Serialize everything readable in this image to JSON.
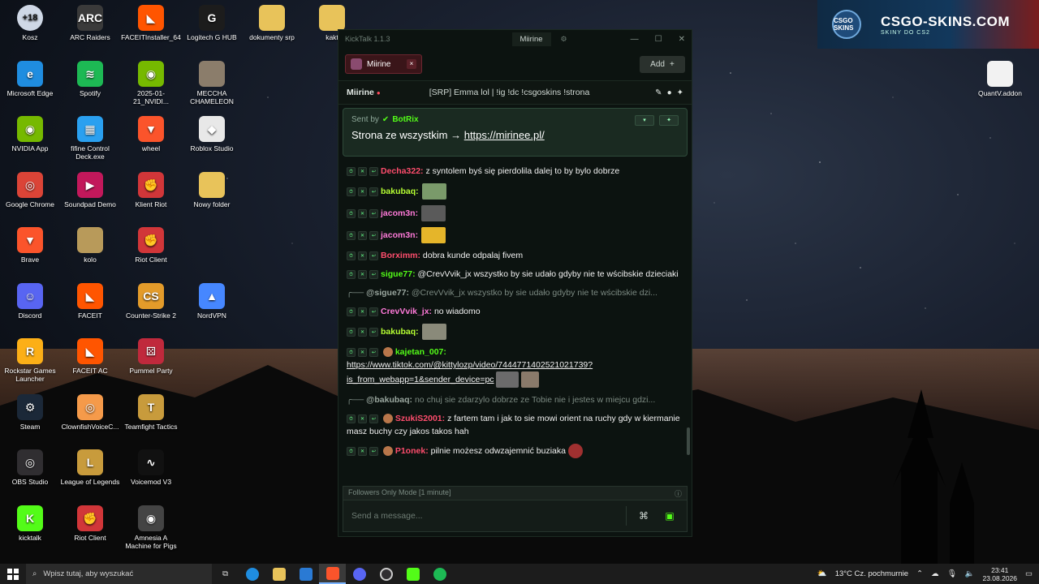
{
  "promo": {
    "badge": "CSGO SKINS",
    "title": "CSGO-SKINS.COM",
    "subtitle": "SKINY DO CS2"
  },
  "desktop_icons": [
    {
      "label": "Kosz",
      "icon": "recycle-bin-icon",
      "color": "#cfd8e6",
      "glyph": "+18"
    },
    {
      "label": "ARC Raiders",
      "icon": "arc-raiders-icon",
      "color": "#3a3a3a",
      "glyph": "ARC"
    },
    {
      "label": "FACEITInstaller_64",
      "icon": "faceit-icon",
      "color": "#ff5500",
      "glyph": "◣"
    },
    {
      "label": "Logitech G HUB",
      "icon": "logitech-icon",
      "color": "#1c1c1c",
      "glyph": "G"
    },
    {
      "label": "dokumenty srp",
      "icon": "folder-icon",
      "color": "#e8c35a",
      "glyph": ""
    },
    {
      "label": "kakt",
      "icon": "folder-icon",
      "color": "#e8c35a",
      "glyph": ""
    },
    {
      "label": "Microsoft Edge",
      "icon": "edge-icon",
      "color": "#1f8de0",
      "glyph": "e"
    },
    {
      "label": "Spotify",
      "icon": "spotify-icon",
      "color": "#1db954",
      "glyph": "≋"
    },
    {
      "label": "2025-01-21_NVIDI...",
      "icon": "nvidia-icon",
      "color": "#76b900",
      "glyph": "◉"
    },
    {
      "label": "MECCHA CHAMELEON",
      "icon": "game-icon",
      "color": "#8b7d6b",
      "glyph": ""
    },
    {
      "label": "NVIDIA App",
      "icon": "nvidia-icon",
      "color": "#76b900",
      "glyph": "◉"
    },
    {
      "label": "fifine Control Deck.exe",
      "icon": "fifine-icon",
      "color": "#2aa0f0",
      "glyph": "▦"
    },
    {
      "label": "wheel",
      "icon": "brave-icon",
      "color": "#fb542b",
      "glyph": "▼"
    },
    {
      "label": "Roblox Studio",
      "icon": "roblox-icon",
      "color": "#e8e8e8",
      "glyph": "◆"
    },
    {
      "label": "Google Chrome",
      "icon": "chrome-icon",
      "color": "#db4437",
      "glyph": "◎"
    },
    {
      "label": "Soundpad Demo",
      "icon": "soundpad-icon",
      "color": "#c2185b",
      "glyph": "▶"
    },
    {
      "label": "Klient Riot",
      "icon": "riot-icon",
      "color": "#d13639",
      "glyph": "✊"
    },
    {
      "label": "Nowy folder",
      "icon": "folder-icon",
      "color": "#e8c35a",
      "glyph": ""
    },
    {
      "label": "Brave",
      "icon": "brave-icon",
      "color": "#fb542b",
      "glyph": "▼"
    },
    {
      "label": "kolo",
      "icon": "archive-icon",
      "color": "#b89a5a",
      "glyph": ""
    },
    {
      "label": "Riot Client",
      "icon": "riot-icon",
      "color": "#d13639",
      "glyph": "✊"
    },
    {
      "label": "Discord",
      "icon": "discord-icon",
      "color": "#5865f2",
      "glyph": "☺"
    },
    {
      "label": "FACEIT",
      "icon": "faceit-icon",
      "color": "#ff5500",
      "glyph": "◣"
    },
    {
      "label": "Counter-Strike 2",
      "icon": "cs2-icon",
      "color": "#e39b2a",
      "glyph": "CS"
    },
    {
      "label": "NordVPN",
      "icon": "nordvpn-icon",
      "color": "#4687ff",
      "glyph": "▲"
    },
    {
      "label": "Rockstar Games Launcher",
      "icon": "rockstar-icon",
      "color": "#fcaf17",
      "glyph": "R"
    },
    {
      "label": "FACEIT AC",
      "icon": "faceit-icon",
      "color": "#ff5500",
      "glyph": "◣"
    },
    {
      "label": "Pummel Party",
      "icon": "pummel-icon",
      "color": "#c0293c",
      "glyph": "⚄"
    },
    {
      "label": "Steam",
      "icon": "steam-icon",
      "color": "#1b2838",
      "glyph": "⚙"
    },
    {
      "label": "ClownfishVoiceC...",
      "icon": "clownfish-icon",
      "color": "#f59a4a",
      "glyph": "◎"
    },
    {
      "label": "Teamfight Tactics",
      "icon": "tft-icon",
      "color": "#c89b3c",
      "glyph": "T"
    },
    {
      "label": "OBS Studio",
      "icon": "obs-icon",
      "color": "#302e31",
      "glyph": "◎"
    },
    {
      "label": "League of Legends",
      "icon": "lol-icon",
      "color": "#c89b3c",
      "glyph": "L"
    },
    {
      "label": "Voicemod V3",
      "icon": "voicemod-icon",
      "color": "#111",
      "glyph": "∿"
    },
    {
      "label": "kicktalk",
      "icon": "kicktalk-icon",
      "color": "#53fc18",
      "glyph": "K"
    },
    {
      "label": "Riot Client",
      "icon": "riot-icon",
      "color": "#d13639",
      "glyph": "✊"
    },
    {
      "label": "Amnesia A Machine for Pigs",
      "icon": "amnesia-icon",
      "color": "#444",
      "glyph": "◉"
    },
    {
      "label": "QuantV.addon",
      "icon": "file-icon",
      "color": "#f2f2f2",
      "glyph": ""
    }
  ],
  "kicktalk": {
    "app_title": "KickTalk 1.1.3",
    "user": "Miirine",
    "tab_label": "Miirine",
    "tab_close": "×",
    "add_label": "Add",
    "add_icon": "+",
    "channel_name": "Miirine",
    "live_dot": "●",
    "stream_title": "[SRP] Emma lol | !ig !dc !csgoskins !strona",
    "pinned": {
      "sent_by": "Sent by",
      "bot": "BotRix",
      "text": "Strona ze wszystkim →",
      "link": "https://mirinee.pl/"
    },
    "messages": [
      {
        "user": "Decha322:",
        "color": "#ff4d6d",
        "text": "z syntolem byś się pierdolila dalej to by bylo dobrze",
        "emotes": []
      },
      {
        "user": "bakubaq:",
        "color": "#b6ff33",
        "text": "",
        "emotes": [
          "#7a9a6a"
        ]
      },
      {
        "user": "jacom3n:",
        "color": "#ff7ad9",
        "text": "",
        "emotes": [
          "#5a5a5a"
        ]
      },
      {
        "user": "jacom3n:",
        "color": "#ff7ad9",
        "text": "",
        "emotes": [
          "#e5b52a"
        ]
      },
      {
        "user": "Borximm:",
        "color": "#ff4d6d",
        "text": "dobra kunde odpalaj fivem",
        "emotes": []
      },
      {
        "user": "sigue77:",
        "color": "#53fc18",
        "text": "@CrevVvik_jx wszystko by sie udało gdyby nie te wścibskie dzieciaki",
        "emotes": []
      }
    ],
    "reply1": {
      "prefix": "╭──",
      "to": "@sigue77:",
      "text": "@CrevVvik_jx wszystko by sie udało gdyby nie te wścibskie dzi..."
    },
    "messages2": [
      {
        "user": "CrevVvik_jx:",
        "color": "#ff7ad9",
        "text": "no wiadomo",
        "emotes": []
      },
      {
        "user": "bakubaq:",
        "color": "#b6ff33",
        "text": "",
        "emotes": [
          "#8a8a7a"
        ]
      }
    ],
    "kajetan": {
      "user": "kajetan_007:",
      "color": "#53fc18",
      "link1": "https://www.tiktok.com/@kittylozp/video/7444771402521021739?",
      "link2": "is_from_webapp=1&sender_device=pc"
    },
    "reply2": {
      "prefix": "╭──",
      "to": "@bakubaq:",
      "text": "no chuj sie zdarzylo dobrze ze Tobie nie i jestes w miejcu gdzi..."
    },
    "szuki": {
      "user": "SzukiS2001:",
      "color": "#ff4d6d",
      "text": "z fartem tam i jak to sie mowi orient na ruchy gdy w kiermanie masz buchy czy jakos takos hah"
    },
    "p1onek": {
      "user": "P1onek:",
      "color": "#ff4d6d",
      "text": "pilnie możesz odwzajemnić buziaka"
    },
    "followers_mode": "Followers Only Mode [1 minute]",
    "input_placeholder": "Send a message..."
  },
  "taskbar": {
    "search_placeholder": "Wpisz tutaj, aby wyszukać",
    "weather": "13°C  Cz. pochmurnie",
    "time": "23:41",
    "date": "23.08.2026"
  }
}
